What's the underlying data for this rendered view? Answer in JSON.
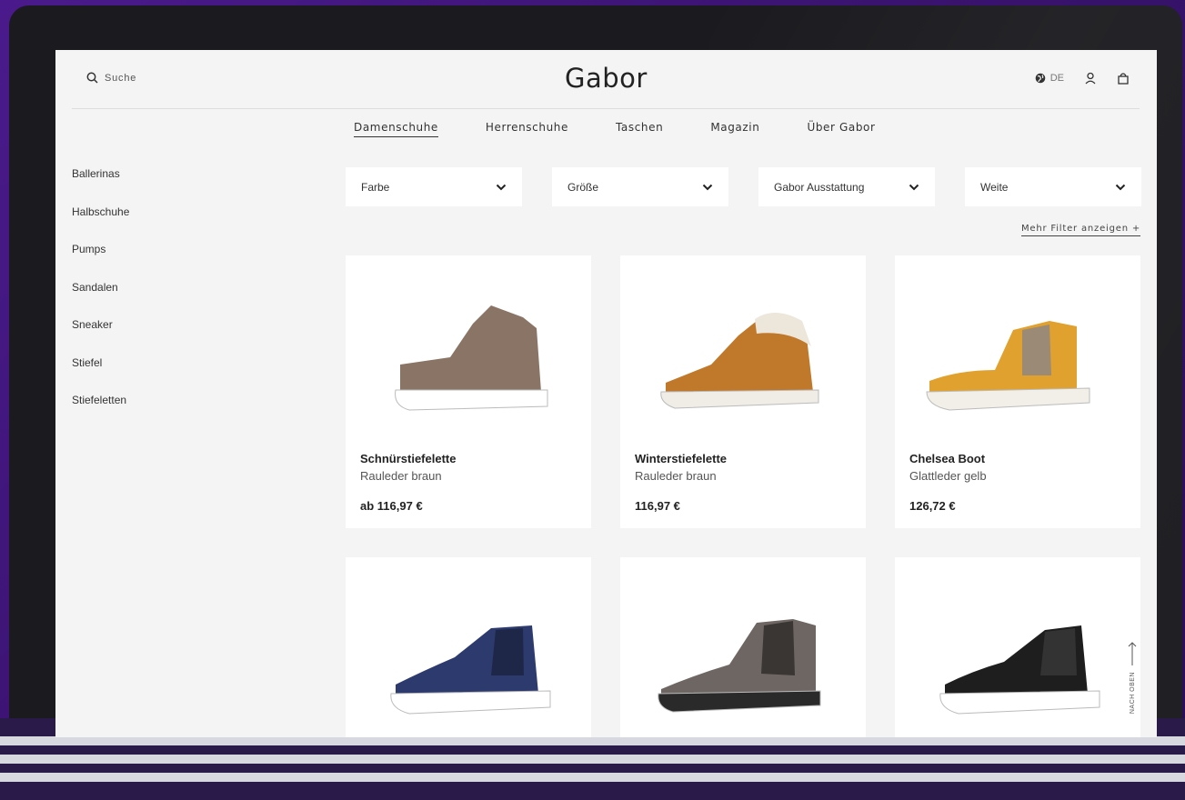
{
  "header": {
    "search_label": "Suche",
    "logo": "Gabor",
    "language": "DE"
  },
  "nav": [
    "Damenschuhe",
    "Herrenschuhe",
    "Taschen",
    "Magazin",
    "Über Gabor"
  ],
  "sidebar": [
    "Ballerinas",
    "Halbschuhe",
    "Pumps",
    "Sandalen",
    "Sneaker",
    "Stiefel",
    "Stiefeletten"
  ],
  "filters": [
    "Farbe",
    "Größe",
    "Gabor Ausstattung",
    "Weite"
  ],
  "more_filters": "Mehr Filter anzeigen +",
  "products": [
    {
      "name": "Schnürstiefelette",
      "desc": "Rauleder braun",
      "price": "ab 116,97 €",
      "color": "#8a7465",
      "sole": "#ffffff"
    },
    {
      "name": "Winterstiefelette",
      "desc": "Rauleder braun",
      "price": "116,97 €",
      "color": "#c0782a",
      "sole": "#f0ece6"
    },
    {
      "name": "Chelsea Boot",
      "desc": "Glattleder gelb",
      "price": "126,72 €",
      "color": "#e0a12e",
      "sole": "#f2efe8"
    },
    {
      "color": "#2d3a6e",
      "sole": "#ffffff"
    },
    {
      "color": "#6e6663",
      "sole": "#2a2a2a"
    },
    {
      "color": "#1e1e1e",
      "sole": "#ffffff"
    }
  ],
  "back_to_top": "NACH OBEN"
}
